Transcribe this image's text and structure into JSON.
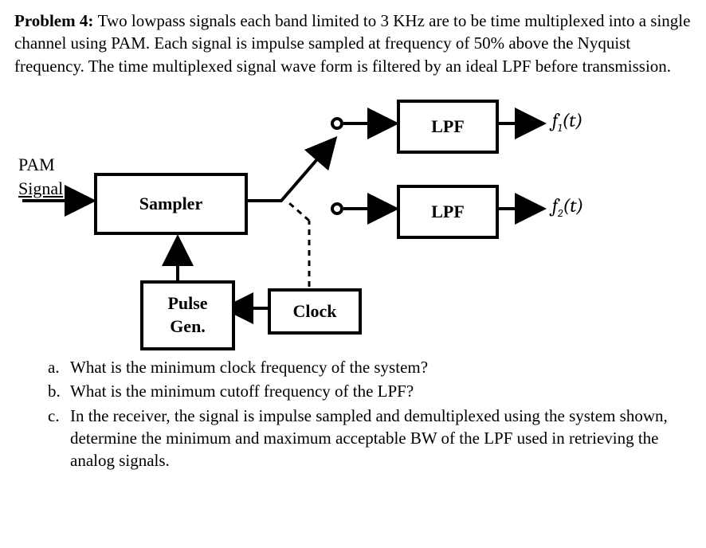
{
  "problem": {
    "header": "Problem 4:",
    "text": "Two lowpass signals each band limited to 3 KHz are to be time multiplexed into a single channel using PAM. Each signal is impulse sampled at frequency of 50% above the Nyquist frequency. The time multiplexed signal wave form is filtered by an ideal LPF before transmission."
  },
  "diagram": {
    "pam_label": "PAM\nSignal",
    "sampler": "Sampler",
    "pulse_gen": "Pulse Gen.",
    "clock": "Clock",
    "lpf1": "LPF",
    "lpf2": "LPF",
    "f1": "f₁(t)",
    "f2": "f₂(t)"
  },
  "questions": {
    "a_label": "a.",
    "a_text": "What is the minimum clock frequency of the system?",
    "b_label": "b.",
    "b_text": "What is the minimum cutoff frequency of the LPF?",
    "c_label": "c.",
    "c_text": "In the receiver, the signal is impulse sampled and demultiplexed using the system shown, determine the minimum and maximum acceptable BW of the LPF used in retrieving the analog signals."
  }
}
